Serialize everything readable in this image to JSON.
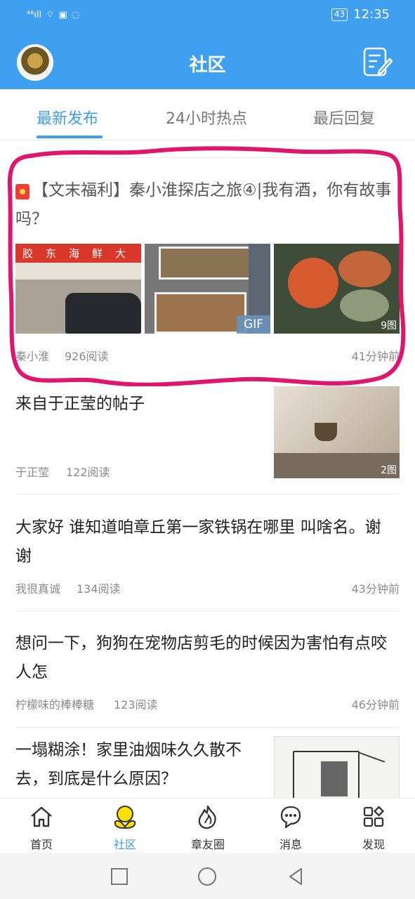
{
  "status": {
    "signal": "⁴⁶ıll",
    "time": "12:35",
    "battery": "43"
  },
  "header": {
    "title": "社区"
  },
  "tabs": [
    {
      "label": "最新发布",
      "active": true
    },
    {
      "label": "24小时热点",
      "active": false
    },
    {
      "label": "最后回复",
      "active": false
    }
  ],
  "posts": [
    {
      "title": "【文末福利】秦小淮探店之旅④|我有酒，你有故事吗？",
      "author": "秦小淮",
      "reads": "926阅读",
      "time": "41分钟前",
      "badge_gif": "GIF",
      "image_count": "9图"
    },
    {
      "title": "来自于正莹的帖子",
      "author": "于正莹",
      "reads": "122阅读",
      "image_count": "2图"
    },
    {
      "title": "大家好 谁知道咱章丘第一家铁锅在哪里 叫啥名。谢谢",
      "author": "我很真诚",
      "reads": "134阅读",
      "time": "43分钟前"
    },
    {
      "title": "想问一下，狗狗在宠物店剪毛的时候因为害怕有点咬人怎",
      "author": "柠檬味的棒棒糖",
      "reads": "123阅读",
      "time": "46分钟前"
    },
    {
      "title": "一塌糊涂！家里油烟味久久散不去，到底是什么原因？"
    }
  ],
  "bottom_nav": [
    {
      "label": "首页",
      "icon": "home-icon",
      "active": false
    },
    {
      "label": "社区",
      "icon": "community-icon",
      "active": true
    },
    {
      "label": "章友圈",
      "icon": "fire-icon",
      "active": false
    },
    {
      "label": "消息",
      "icon": "message-icon",
      "active": false
    },
    {
      "label": "发现",
      "icon": "discover-icon",
      "active": false
    }
  ],
  "colors": {
    "brand": "#3f9ff0",
    "tab_active": "#3e9ee9",
    "highlight": "#e0156b"
  }
}
